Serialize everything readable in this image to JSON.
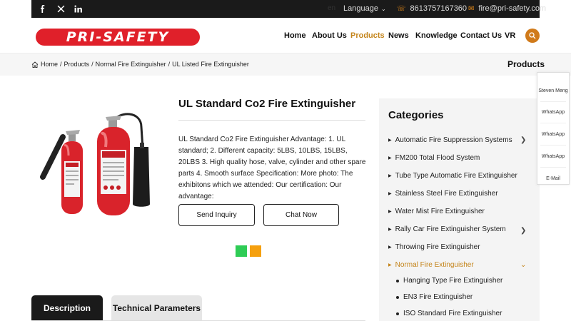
{
  "topbar": {
    "social": [
      "facebook-icon",
      "x-icon",
      "linkedin-icon"
    ],
    "lang_code": "en",
    "language_label": "Language",
    "phone": "8613757167360",
    "email": "fire@pri-safety.com"
  },
  "header": {
    "logo_text": "PRI-SAFETY",
    "brand_color": "#e0202a",
    "accent_color": "#c4841a",
    "nav": [
      "Home",
      "About Us",
      "Products",
      "News",
      "Knowledge",
      "Contact Us",
      "VR"
    ],
    "active_nav": "Products"
  },
  "breadcrumb": {
    "items": [
      "Home",
      "Products",
      "Normal Fire Extinguisher",
      "UL Listed Fire Extinguisher"
    ],
    "section_title": "Products"
  },
  "product": {
    "title": "UL Standard Co2 Fire Extinguisher",
    "description": "UL Standard Co2 Fire Extinguisher Advantage: 1. UL standard; 2. Different capacity: 5LBS, 10LBS, 15LBS, 20LBS 3. High quality hose, valve, cylinder and other spare parts 4. Smooth surface Specification: More photo: The exhibitons which we attended: Our certification: Our advantage:",
    "inquiry_button": "Send Inquiry",
    "chat_button": "Chat Now",
    "share_colors": [
      "#2ecc55",
      "#f5a00f"
    ]
  },
  "tabs": {
    "description": "Description",
    "technical": "Technical Parameters"
  },
  "categories": {
    "title": "Categories",
    "items": [
      {
        "label": "Automatic Fire Suppression Systems",
        "expandable": true
      },
      {
        "label": "FM200 Total Flood System",
        "expandable": false
      },
      {
        "label": "Tube Type Automatic Fire Extinguisher",
        "expandable": false
      },
      {
        "label": "Stainless Steel Fire Extinguisher",
        "expandable": false
      },
      {
        "label": "Water Mist Fire Extinguisher",
        "expandable": false
      },
      {
        "label": "Rally Car Fire Extinguisher System",
        "expandable": true
      },
      {
        "label": "Throwing Fire Extinguisher",
        "expandable": false
      },
      {
        "label": "Normal Fire Extinguisher",
        "expandable": true,
        "active": true
      }
    ],
    "subitems": [
      "Hanging Type Fire Extinguisher",
      "EN3 Fire Extinguisher",
      "ISO Standard Fire Extinguisher"
    ]
  },
  "float_bar": {
    "items": [
      "Steven Meng",
      "WhatsApp",
      "WhatsApp",
      "WhatsApp",
      "E-Mail"
    ]
  }
}
